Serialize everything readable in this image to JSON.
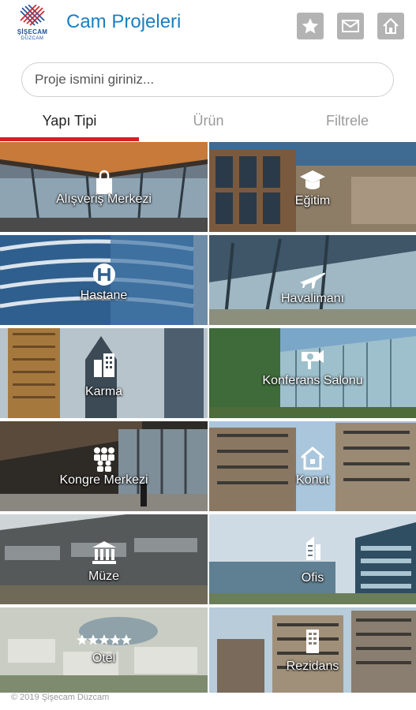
{
  "brand": {
    "logo_line1": "ŞİŞECAM",
    "logo_line2": "DÜZCAM"
  },
  "header": {
    "title": "Cam Projeleri",
    "favorites_icon": "star-icon",
    "mail_icon": "mail-icon",
    "home_icon": "home-icon"
  },
  "search": {
    "placeholder": "Proje ismini giriniz...",
    "value": ""
  },
  "tabs": [
    {
      "label": "Yapı Tipi",
      "active": true
    },
    {
      "label": "Ürün",
      "active": false
    },
    {
      "label": "Filtrele",
      "active": false
    }
  ],
  "categories": [
    {
      "label": "Alışveriş Merkezi",
      "icon": "shopping-bag-icon"
    },
    {
      "label": "Eğitim",
      "icon": "graduation-cap-icon"
    },
    {
      "label": "Hastane",
      "icon": "hospital-icon"
    },
    {
      "label": "Havalimanı",
      "icon": "airplane-icon"
    },
    {
      "label": "Karma",
      "icon": "buildings-icon"
    },
    {
      "label": "Konferans Salonu",
      "icon": "projector-icon"
    },
    {
      "label": "Kongre Merkezi",
      "icon": "people-icon"
    },
    {
      "label": "Konut",
      "icon": "house-icon"
    },
    {
      "label": "Müze",
      "icon": "museum-icon"
    },
    {
      "label": "Ofis",
      "icon": "office-tower-icon"
    },
    {
      "label": "Otel",
      "icon": "stars-icon"
    },
    {
      "label": "Rezidans",
      "icon": "residence-icon"
    }
  ],
  "footer": {
    "copyright": "© 2019 Şişecam Düzcam"
  },
  "colors": {
    "title_blue": "#1a7fc1",
    "active_tab_underline": "#d42026",
    "header_button_gray": "#b3b3b3"
  }
}
